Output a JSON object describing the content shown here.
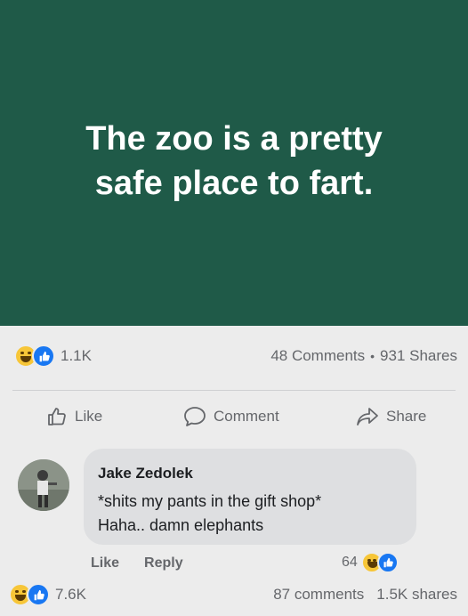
{
  "post": {
    "text": "The zoo is a pretty safe place to fart.",
    "bg_color": "#1f5a48",
    "reaction_icons": [
      "laugh-emoji-icon",
      "like-reaction-icon"
    ],
    "reaction_count": "1.1K",
    "comments_count": "48 Comments",
    "separator": "•",
    "shares_count": "931 Shares"
  },
  "actions": {
    "like": "Like",
    "comment": "Comment",
    "share": "Share"
  },
  "comment": {
    "author": "Jake Zedolek",
    "line1": "*shits my pants in the gift shop*",
    "line2": "Haha.. damn elephants",
    "like": "Like",
    "reply": "Reply",
    "reaction_count": "64"
  },
  "footer": {
    "reaction_count": "7.6K",
    "comments": "87 comments",
    "shares": "1.5K shares"
  },
  "colors": {
    "accent": "#1877f2",
    "emoji": "#f7c638"
  }
}
